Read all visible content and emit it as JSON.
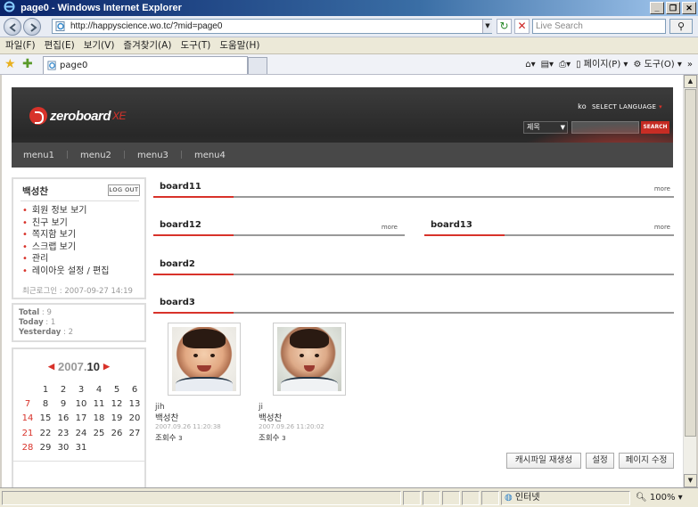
{
  "window": {
    "title": "page0 - Windows Internet Explorer",
    "min": "_",
    "restore": "❐",
    "close": "✕"
  },
  "address": {
    "url": "http://happyscience.wo.tc/?mid=page0",
    "search_placeholder": "Live Search"
  },
  "menu": [
    "파일(F)",
    "편집(E)",
    "보기(V)",
    "즐겨찾기(A)",
    "도구(T)",
    "도움말(H)"
  ],
  "tab": {
    "label": "page0"
  },
  "toolbar": {
    "page_label": "페이지(P)",
    "tools_label": "도구(O)"
  },
  "status": {
    "zone": "인터넷",
    "zoom": "100%"
  },
  "site": {
    "logo_text": "zeroboard",
    "logo_suffix": "XE",
    "lang_code": "ko",
    "lang_label": "SELECT LANGUAGE",
    "search_select": "제목",
    "search_button": "SEARCH",
    "nav": [
      "menu1",
      "menu2",
      "menu3",
      "menu4"
    ]
  },
  "login": {
    "name": "백성찬",
    "logout": "LOG OUT",
    "menu": [
      "회원 정보 보기",
      "친구 보기",
      "쪽지함 보기",
      "스크랩 보기",
      "관리",
      "레이아웃 설정 / 편집"
    ],
    "last_login": "최근로그인 : 2007-09-27 14:19"
  },
  "counter": {
    "total_label": "Total",
    "total": "9",
    "today_label": "Today",
    "today": "1",
    "yesterday_label": "Yesterday",
    "yesterday": "2"
  },
  "calendar": {
    "year": "2007",
    "month": "10",
    "weeks": [
      [
        "",
        "1",
        "2",
        "3",
        "4",
        "5",
        "6"
      ],
      [
        "7",
        "8",
        "9",
        "10",
        "11",
        "12",
        "13"
      ],
      [
        "14",
        "15",
        "16",
        "17",
        "18",
        "19",
        "20"
      ],
      [
        "21",
        "22",
        "23",
        "24",
        "25",
        "26",
        "27"
      ],
      [
        "28",
        "29",
        "30",
        "31",
        "",
        "",
        ""
      ]
    ]
  },
  "boards": {
    "board11": {
      "title": "board11",
      "more": "more"
    },
    "board12": {
      "title": "board12",
      "more": "more"
    },
    "board13": {
      "title": "board13",
      "more": "more"
    },
    "board2": {
      "title": "board2"
    },
    "board3": {
      "title": "board3"
    }
  },
  "gallery": [
    {
      "author": "jih",
      "title": "백성찬",
      "date": "2007.09.26 11:20:38",
      "views_label": "조회수",
      "views": "3"
    },
    {
      "author": "ji",
      "title": "백성찬",
      "date": "2007.09.26 11:20:02",
      "views_label": "조회수",
      "views": "3"
    }
  ],
  "page_buttons": {
    "cache": "캐시파일 재생성",
    "settings": "설정",
    "edit": "페이지 수정"
  }
}
